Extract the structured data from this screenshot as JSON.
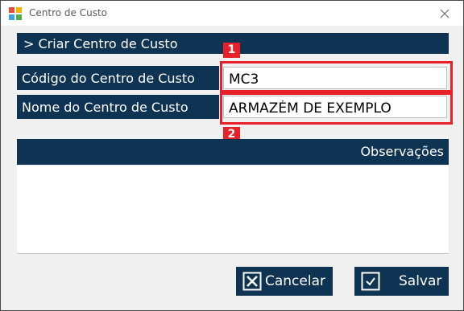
{
  "window": {
    "title": "Centro de Custo",
    "close_icon": "close-icon"
  },
  "section": {
    "header": "> Criar Centro de Custo"
  },
  "form": {
    "code_label": "Código do Centro de Custo",
    "code_value": "MC3",
    "name_label": "Nome do Centro de Custo",
    "name_value": "ARMAZÉM DE EXEMPLO",
    "notes_label": "Observações",
    "notes_value": ""
  },
  "annotations": {
    "badge_1": "1",
    "badge_2": "2",
    "color": "#e8202a"
  },
  "buttons": {
    "cancel_label": "Cancelar",
    "cancel_icon": "x-box-icon",
    "save_label": "Salvar",
    "save_icon": "check-box-icon"
  },
  "colors": {
    "navy": "#0f3352",
    "highlight": "#e8202a"
  }
}
